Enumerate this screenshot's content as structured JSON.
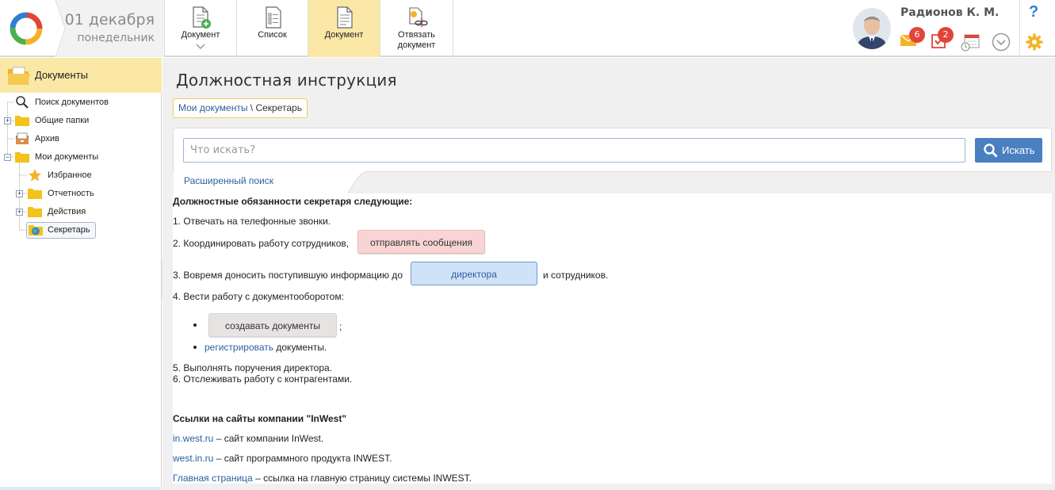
{
  "header": {
    "date_day": "01 декабря",
    "date_weekday": "понедельник",
    "toolbar": [
      {
        "label": "Документ",
        "icon": "document-add-icon",
        "dropdown": true
      },
      {
        "label": "Список",
        "icon": "list-icon"
      },
      {
        "label": "Документ",
        "icon": "document-icon",
        "active": true
      },
      {
        "label_line1": "Отвязать",
        "label_line2": "документ",
        "icon": "unlink-document-icon"
      }
    ],
    "user_name": "Радионов К. М.",
    "mail_count": "6",
    "tasks_count": "2",
    "help_glyph": "?"
  },
  "sidebar": {
    "title": "Документы",
    "items": [
      {
        "label": "Поиск документов",
        "icon": "search-icon"
      },
      {
        "label": "Общие папки",
        "icon": "folder-icon"
      },
      {
        "label": "Архив",
        "icon": "archive-icon"
      },
      {
        "label": "Мои документы",
        "icon": "folder-icon"
      },
      {
        "label": "Избранное",
        "icon": "star-icon"
      },
      {
        "label": "Отчетность",
        "icon": "folder-icon"
      },
      {
        "label": "Действия",
        "icon": "folder-icon"
      },
      {
        "label": "Секретарь",
        "icon": "globe-folder-icon",
        "selected": true
      }
    ]
  },
  "main": {
    "title": "Должностная инструкция",
    "breadcrumb": {
      "link": "Мои документы",
      "separator": " \\ ",
      "current": "Секретарь"
    },
    "search": {
      "placeholder": "Что искать?",
      "button": "Искать",
      "advanced": "Расширенный поиск"
    },
    "doc": {
      "heading": "Должностные обязанности секретаря следующие:",
      "l1": "1. Отвечать на телефонные звонки.",
      "l2": "2. Координировать работу сотрудников,",
      "l2_btn": "отправлять сообщения",
      "l3": "3. Вовремя доносить поступившую информацию до",
      "l3_btn": "директора",
      "l3_after": "и сотрудников.",
      "l4": "4. Вести работу с документооборотом:",
      "b1_btn": "создавать документы",
      "b1_after": ";",
      "b2_link": "регистрировать",
      "b2_after": " документы.",
      "l5": "5. Выполнять поручения директора.",
      "l6": "6. Отслеживать работу с контрагентами.",
      "links_heading": "Ссылки на сайты компании \"InWest\"",
      "link1": "in.west.ru",
      "link1_desc": " – сайт компании InWest.",
      "link2": "west.in.ru",
      "link2_desc": " – сайт программного продукта INWEST.",
      "link3": "Главная страница",
      "link3_desc": " – ссылка на главную страницу системы INWEST."
    }
  }
}
